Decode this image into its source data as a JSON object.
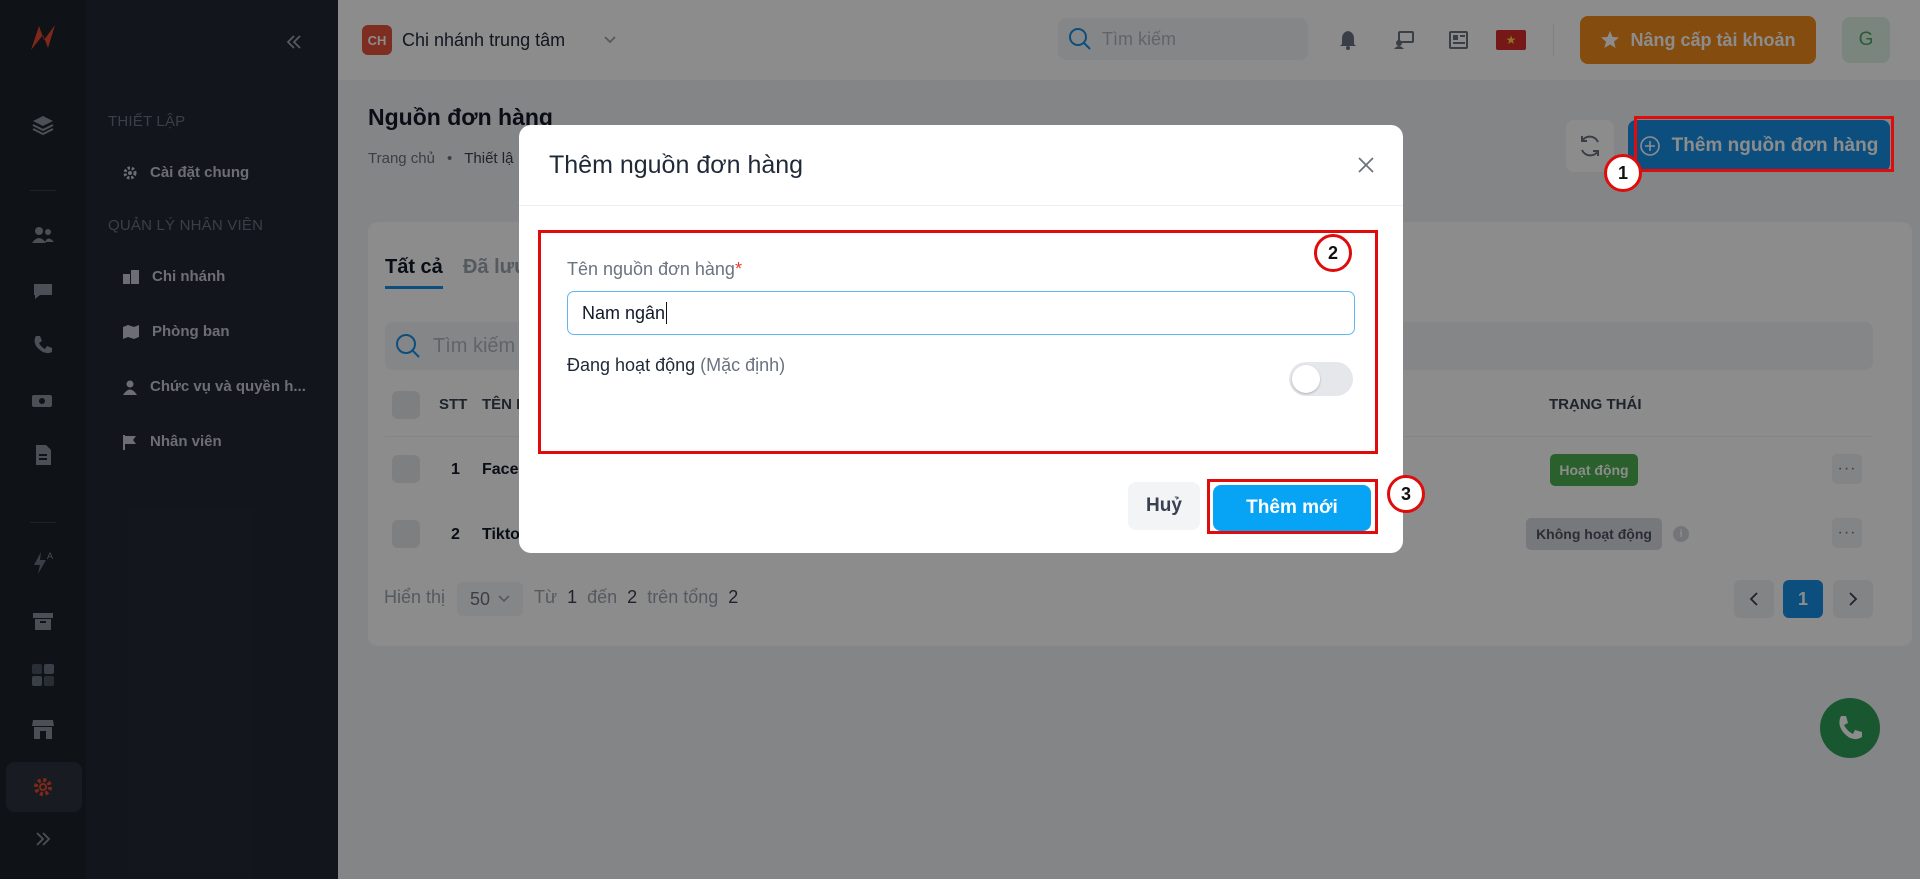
{
  "sidebar": {
    "section_setup": "THIẾT LẬP",
    "item_general": "Cài đặt chung",
    "section_staff": "QUẢN LÝ NHÂN VIÊN",
    "item_branch": "Chi nhánh",
    "item_department": "Phòng ban",
    "item_roles": "Chức vụ và quyền h...",
    "item_staff": "Nhân viên"
  },
  "topbar": {
    "branch_badge": "CH",
    "branch_name": "Chi nhánh trung tâm",
    "search_placeholder": "Tìm kiếm",
    "upgrade_label": "Nâng cấp tài khoản",
    "avatar_initial": "G"
  },
  "page": {
    "title": "Nguồn đơn hàng",
    "breadcrumb_home": "Trang chủ",
    "breadcrumb_sep": "•",
    "breadcrumb_current": "Thiết lậ",
    "add_button": "Thêm nguồn đơn hàng",
    "tab_all": "Tất cả",
    "tab_saved": "Đã lưu",
    "search_placeholder": "Tìm kiếm",
    "col_stt": "STT",
    "col_name": "TÊN I",
    "col_status": "TRẠNG THÁI",
    "rows": [
      {
        "stt": "1",
        "name": "Face",
        "status": "Hoạt động"
      },
      {
        "stt": "2",
        "name": "Tikto",
        "status": "Không hoạt động"
      }
    ],
    "pager": {
      "show": "Hiển thị",
      "per_page": "50",
      "from": "Từ",
      "from_val": "1",
      "to": "đến",
      "to_val": "2",
      "total": "trên tổng",
      "total_val": "2",
      "current_page": "1"
    }
  },
  "modal": {
    "title": "Thêm nguồn đơn hàng",
    "field_label": "Tên nguồn đơn hàng",
    "required_mark": "*",
    "field_value": "Nam ngân",
    "toggle_label": "Đang hoạt động",
    "toggle_hint": "(Mặc định)",
    "toggle_on": false,
    "cancel_label": "Huỷ",
    "submit_label": "Thêm mới"
  },
  "annotations": [
    "1",
    "2",
    "3"
  ],
  "colors": {
    "primary": "#1690e8",
    "submit": "#07a3f5",
    "upgrade": "#f08a1c",
    "annotation": "#e00b0b",
    "active_badge": "#4caf50"
  }
}
